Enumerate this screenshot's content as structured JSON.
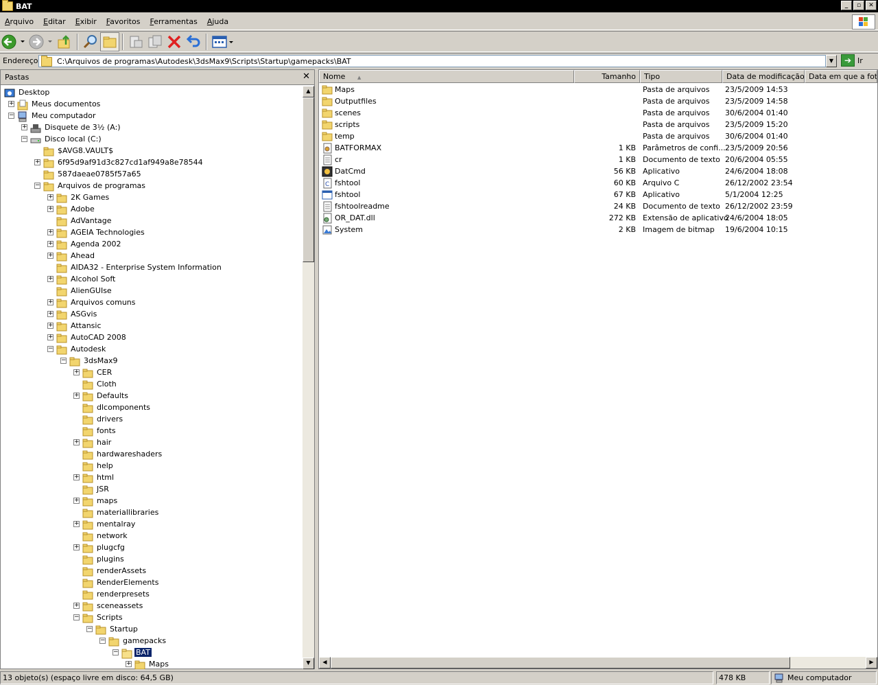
{
  "window": {
    "title": "BAT",
    "buttons": [
      "_",
      "▫",
      "✕"
    ]
  },
  "menu": {
    "items": [
      {
        "key": "A",
        "rest": "rquivo"
      },
      {
        "key": "E",
        "rest": "ditar"
      },
      {
        "key": "E",
        "rest": "xibir"
      },
      {
        "key": "F",
        "rest": "avoritos"
      },
      {
        "key": "F",
        "rest": "erramentas"
      },
      {
        "key": "A",
        "rest": "juda"
      }
    ]
  },
  "toolbar": {
    "icons": [
      "back-icon",
      "forward-icon",
      "up-folder-icon",
      "search-icon",
      "folders-icon",
      "move-to-icon",
      "copy-to-icon",
      "delete-icon",
      "undo-icon",
      "views-icon"
    ]
  },
  "address": {
    "label": "Endereço",
    "value": "C:\\Arquivos de programas\\Autodesk\\3dsMax9\\Scripts\\Startup\\gamepacks\\BAT",
    "go_label": "Ir"
  },
  "folders_pane": {
    "title": "Pastas",
    "close": "✕",
    "tree": [
      {
        "label": "Desktop",
        "level": 0,
        "exp": "",
        "icon": "desktop"
      },
      {
        "label": "Meus documentos",
        "level": 1,
        "exp": "+",
        "icon": "docs"
      },
      {
        "label": "Meu computador",
        "level": 1,
        "exp": "-",
        "icon": "computer"
      },
      {
        "label": "Disquete de 3½ (A:)",
        "level": 2,
        "exp": "+",
        "icon": "floppy"
      },
      {
        "label": "Disco local (C:)",
        "level": 2,
        "exp": "-",
        "icon": "drive"
      },
      {
        "label": "$AVG8.VAULT$",
        "level": 3,
        "exp": "",
        "icon": "folder"
      },
      {
        "label": "6f95d9af91d3c827cd1af949a8e78544",
        "level": 3,
        "exp": "+",
        "icon": "folder"
      },
      {
        "label": "587daeae0785f57a65",
        "level": 3,
        "exp": "",
        "icon": "folder"
      },
      {
        "label": "Arquivos de programas",
        "level": 3,
        "exp": "-",
        "icon": "folder"
      },
      {
        "label": "2K Games",
        "level": 4,
        "exp": "+",
        "icon": "folder"
      },
      {
        "label": "Adobe",
        "level": 4,
        "exp": "+",
        "icon": "folder"
      },
      {
        "label": "AdVantage",
        "level": 4,
        "exp": "",
        "icon": "folder"
      },
      {
        "label": "AGEIA Technologies",
        "level": 4,
        "exp": "+",
        "icon": "folder"
      },
      {
        "label": "Agenda 2002",
        "level": 4,
        "exp": "+",
        "icon": "folder"
      },
      {
        "label": "Ahead",
        "level": 4,
        "exp": "+",
        "icon": "folder"
      },
      {
        "label": "AIDA32 - Enterprise System Information",
        "level": 4,
        "exp": "",
        "icon": "folder"
      },
      {
        "label": "Alcohol Soft",
        "level": 4,
        "exp": "+",
        "icon": "folder"
      },
      {
        "label": "AlienGUIse",
        "level": 4,
        "exp": "",
        "icon": "folder"
      },
      {
        "label": "Arquivos comuns",
        "level": 4,
        "exp": "+",
        "icon": "folder"
      },
      {
        "label": "ASGvis",
        "level": 4,
        "exp": "+",
        "icon": "folder"
      },
      {
        "label": "Attansic",
        "level": 4,
        "exp": "+",
        "icon": "folder"
      },
      {
        "label": "AutoCAD 2008",
        "level": 4,
        "exp": "+",
        "icon": "folder"
      },
      {
        "label": "Autodesk",
        "level": 4,
        "exp": "-",
        "icon": "folder"
      },
      {
        "label": "3dsMax9",
        "level": 5,
        "exp": "-",
        "icon": "folder"
      },
      {
        "label": "CER",
        "level": 6,
        "exp": "+",
        "icon": "folder"
      },
      {
        "label": "Cloth",
        "level": 6,
        "exp": "",
        "icon": "folder"
      },
      {
        "label": "Defaults",
        "level": 6,
        "exp": "+",
        "icon": "folder"
      },
      {
        "label": "dlcomponents",
        "level": 6,
        "exp": "",
        "icon": "folder"
      },
      {
        "label": "drivers",
        "level": 6,
        "exp": "",
        "icon": "folder"
      },
      {
        "label": "fonts",
        "level": 6,
        "exp": "",
        "icon": "folder"
      },
      {
        "label": "hair",
        "level": 6,
        "exp": "+",
        "icon": "folder"
      },
      {
        "label": "hardwareshaders",
        "level": 6,
        "exp": "",
        "icon": "folder"
      },
      {
        "label": "help",
        "level": 6,
        "exp": "",
        "icon": "folder"
      },
      {
        "label": "html",
        "level": 6,
        "exp": "+",
        "icon": "folder"
      },
      {
        "label": "JSR",
        "level": 6,
        "exp": "",
        "icon": "folder"
      },
      {
        "label": "maps",
        "level": 6,
        "exp": "+",
        "icon": "folder"
      },
      {
        "label": "materiallibraries",
        "level": 6,
        "exp": "",
        "icon": "folder"
      },
      {
        "label": "mentalray",
        "level": 6,
        "exp": "+",
        "icon": "folder"
      },
      {
        "label": "network",
        "level": 6,
        "exp": "",
        "icon": "folder"
      },
      {
        "label": "plugcfg",
        "level": 6,
        "exp": "+",
        "icon": "folder"
      },
      {
        "label": "plugins",
        "level": 6,
        "exp": "",
        "icon": "folder"
      },
      {
        "label": "renderAssets",
        "level": 6,
        "exp": "",
        "icon": "folder"
      },
      {
        "label": "RenderElements",
        "level": 6,
        "exp": "",
        "icon": "folder"
      },
      {
        "label": "renderpresets",
        "level": 6,
        "exp": "",
        "icon": "folder"
      },
      {
        "label": "sceneassets",
        "level": 6,
        "exp": "+",
        "icon": "folder"
      },
      {
        "label": "Scripts",
        "level": 6,
        "exp": "-",
        "icon": "folder"
      },
      {
        "label": "Startup",
        "level": 7,
        "exp": "-",
        "icon": "folder"
      },
      {
        "label": "gamepacks",
        "level": 8,
        "exp": "-",
        "icon": "folder"
      },
      {
        "label": "BAT",
        "level": 9,
        "exp": "-",
        "icon": "folder-open",
        "selected": true
      },
      {
        "label": "Maps",
        "level": 10,
        "exp": "+",
        "icon": "folder"
      }
    ]
  },
  "file_list": {
    "columns": [
      "Nome",
      "Tamanho",
      "Tipo",
      "Data de modificação",
      "Data em que a foto ..."
    ],
    "sort_indicator": "▲",
    "rows": [
      {
        "name": "Maps",
        "size": "",
        "type": "Pasta de arquivos",
        "modified": "23/5/2009 14:53",
        "icon": "folder"
      },
      {
        "name": "Outputfiles",
        "size": "",
        "type": "Pasta de arquivos",
        "modified": "23/5/2009 14:58",
        "icon": "folder"
      },
      {
        "name": "scenes",
        "size": "",
        "type": "Pasta de arquivos",
        "modified": "30/6/2004 01:40",
        "icon": "folder"
      },
      {
        "name": "scripts",
        "size": "",
        "type": "Pasta de arquivos",
        "modified": "23/5/2009 15:20",
        "icon": "folder"
      },
      {
        "name": "temp",
        "size": "",
        "type": "Pasta de arquivos",
        "modified": "30/6/2004 01:40",
        "icon": "folder"
      },
      {
        "name": "BATFORMAX",
        "size": "1 KB",
        "type": "Parâmetros de confi...",
        "modified": "23/5/2009 20:56",
        "icon": "config"
      },
      {
        "name": "cr",
        "size": "1 KB",
        "type": "Documento de texto",
        "modified": "20/6/2004 05:55",
        "icon": "text"
      },
      {
        "name": "DatCmd",
        "size": "56 KB",
        "type": "Aplicativo",
        "modified": "24/6/2004 18:08",
        "icon": "app"
      },
      {
        "name": "fshtool",
        "size": "60 KB",
        "type": "Arquivo C",
        "modified": "26/12/2002 23:54",
        "icon": "cfile"
      },
      {
        "name": "fshtool",
        "size": "67 KB",
        "type": "Aplicativo",
        "modified": "5/1/2004 12:25",
        "icon": "window"
      },
      {
        "name": "fshtoolreadme",
        "size": "24 KB",
        "type": "Documento de texto",
        "modified": "26/12/2002 23:59",
        "icon": "text"
      },
      {
        "name": "OR_DAT.dll",
        "size": "272 KB",
        "type": "Extensão de aplicativo",
        "modified": "24/6/2004 18:05",
        "icon": "dll"
      },
      {
        "name": "System",
        "size": "2 KB",
        "type": "Imagem de bitmap",
        "modified": "19/6/2004 10:15",
        "icon": "bitmap"
      }
    ]
  },
  "status": {
    "objects": "13 objeto(s) (espaço livre em disco: 64,5 GB)",
    "size": "478 KB",
    "location": "Meu computador"
  },
  "colors": {
    "selection": "#0a246a",
    "folder": "#f2d56e",
    "chrome": "#d4d0c8"
  }
}
